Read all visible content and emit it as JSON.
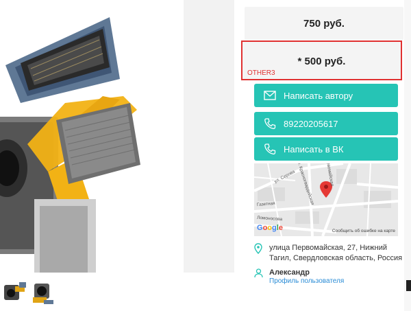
{
  "product": {
    "photo_icon": "camera-module-photo"
  },
  "prices": {
    "old": "750 руб.",
    "highlighted": "* 500 руб.",
    "tag": "OTHER3"
  },
  "buttons": {
    "message": {
      "label": "Написать автору",
      "icon": "envelope-icon"
    },
    "phone": {
      "label": "89220205617",
      "icon": "phone-icon"
    },
    "vk": {
      "label": "Написать в ВК",
      "icon": "phone-icon"
    }
  },
  "map": {
    "streets": [
      "ул. Серова",
      "ул. Красногвардейская",
      "Газетная",
      "Ломоносова",
      "Первомайская"
    ],
    "brand": "Google",
    "report_text": "Сообщить об ошибке на карте"
  },
  "location": {
    "icon": "map-pin-icon",
    "address": "улица Первомайская, 27, Нижний Тагил, Свердловская область, Россия"
  },
  "seller": {
    "icon": "user-icon",
    "name": "Александр",
    "profile_link": "Профиль пользователя"
  },
  "colors": {
    "accent": "#26c4b5",
    "highlight_border": "#e03030",
    "link": "#2a8cd6"
  }
}
